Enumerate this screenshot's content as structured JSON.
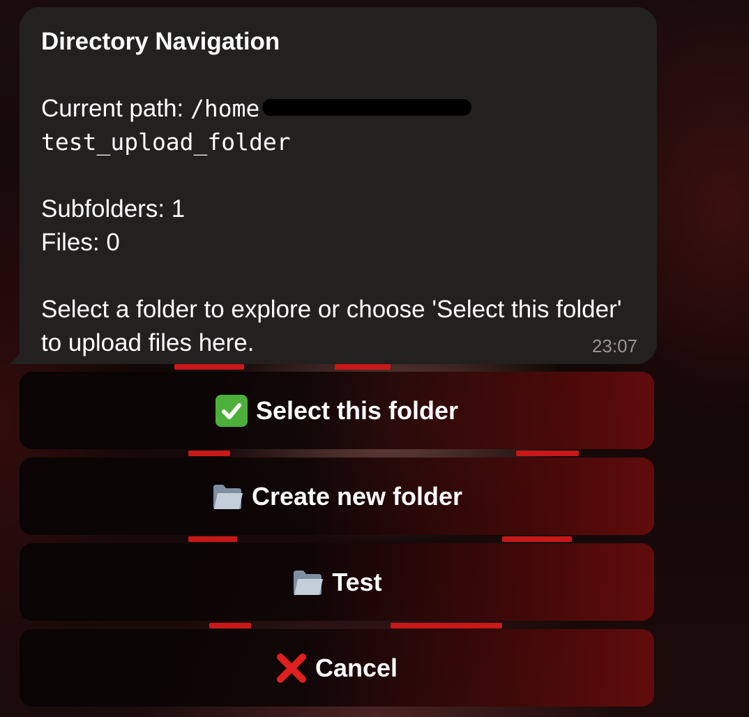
{
  "message": {
    "title": "Directory Navigation",
    "path_label": "Current path:",
    "path_start": "/home",
    "path_end": "test_upload_folder",
    "subfolders": "Subfolders: 1",
    "files": "Files: 0",
    "instruction": "Select a folder to explore or choose 'Select this folder' to upload files here.",
    "time": "23:07"
  },
  "buttons": [
    {
      "label": "Select this folder",
      "icon": "check-mark-icon"
    },
    {
      "label": "Create new folder",
      "icon": "folder-icon"
    },
    {
      "label": "Test",
      "icon": "folder-icon"
    },
    {
      "label": "Cancel",
      "icon": "cross-mark-icon"
    }
  ],
  "colors": {
    "bubble": "#232020",
    "check": "#4cb03a",
    "cross": "#e0201e",
    "accent_red": "#c81818"
  }
}
